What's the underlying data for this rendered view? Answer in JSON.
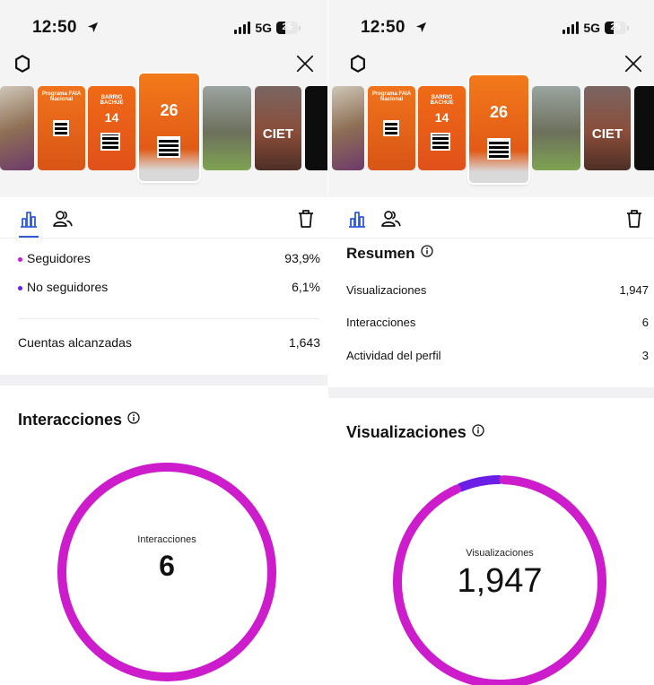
{
  "left": {
    "status": {
      "time": "12:50",
      "network": "5G",
      "battery": "25"
    },
    "metrics": [
      {
        "label": "Seguidores",
        "value": "93,9%",
        "dot_color": "#c21bd0"
      },
      {
        "label": "No seguidores",
        "value": "6,1%",
        "dot_color": "#6a1ee6"
      }
    ],
    "reach": {
      "label": "Cuentas alcanzadas",
      "value": "1,643"
    },
    "section": {
      "title": "Interacciones"
    },
    "donut": {
      "label": "Interacciones",
      "value": "6",
      "followers_fraction": 1.0,
      "color_followers": "#cc1ccc",
      "color_non_followers": "#6a1ee6"
    }
  },
  "right": {
    "status": {
      "time": "12:50",
      "network": "5G",
      "battery": "25"
    },
    "summary": {
      "title": "Resumen",
      "rows": [
        {
          "label": "Visualizaciones",
          "value": "1,947"
        },
        {
          "label": "Interacciones",
          "value": "6"
        },
        {
          "label": "Actividad del perfil",
          "value": "3"
        }
      ]
    },
    "section": {
      "title": "Visualizaciones"
    },
    "donut": {
      "label": "Visualizaciones",
      "value": "1,947",
      "followers_fraction": 0.939,
      "non_followers_fraction": 0.061,
      "color_followers": "#cc1ccc",
      "color_non_followers": "#6a1ee6"
    }
  },
  "thumbnails": {
    "captions": [
      "Programa FAIA Nacional",
      "BARRIO BACHUE",
      "14",
      "26",
      "CIET"
    ]
  },
  "colors": {
    "accent": "#2f5bd9",
    "header_bg": "#f4f4f5"
  },
  "icons": [
    "navigation-arrow-icon",
    "signal-icon",
    "battery-icon",
    "settings-icon",
    "close-icon",
    "bar-chart-icon",
    "audience-icon",
    "trash-icon",
    "info-icon"
  ]
}
